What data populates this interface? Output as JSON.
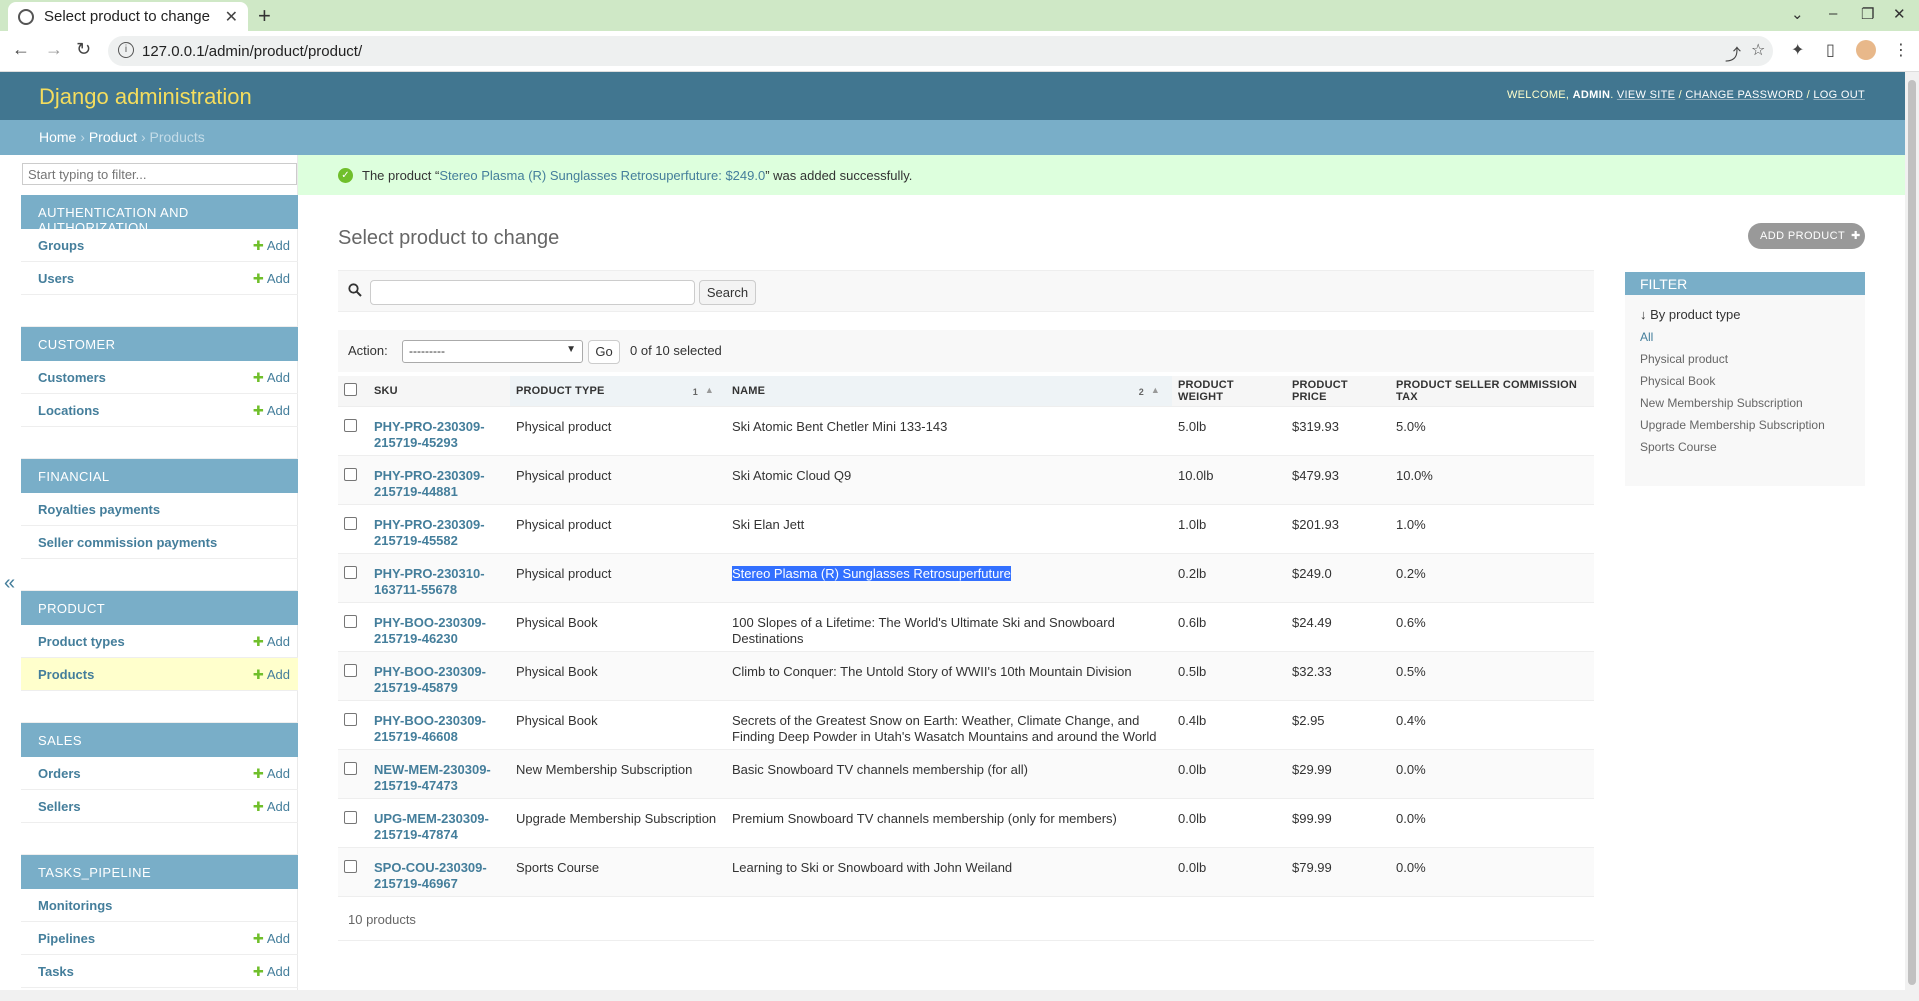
{
  "browser": {
    "tab_title": "Select product to change",
    "url": "127.0.0.1/admin/product/product/"
  },
  "header": {
    "branding": "Django administration",
    "welcome": "WELCOME,",
    "user": "ADMIN",
    "view_site": "VIEW SITE",
    "change_password": "CHANGE PASSWORD",
    "log_out": "LOG OUT"
  },
  "breadcrumbs": {
    "home": "Home",
    "app": "Product",
    "current": "Products"
  },
  "sidebar": {
    "filter_placeholder": "Start typing to filter...",
    "add_label": "Add",
    "apps": [
      {
        "caption": "AUTHENTICATION AND AUTHORIZATION",
        "models": [
          {
            "name": "Groups",
            "add": true
          },
          {
            "name": "Users",
            "add": true
          }
        ]
      },
      {
        "caption": "CUSTOMER",
        "models": [
          {
            "name": "Customers",
            "add": true
          },
          {
            "name": "Locations",
            "add": true
          }
        ]
      },
      {
        "caption": "FINANCIAL",
        "models": [
          {
            "name": "Royalties payments",
            "add": false
          },
          {
            "name": "Seller commission payments",
            "add": false
          }
        ]
      },
      {
        "caption": "PRODUCT",
        "models": [
          {
            "name": "Product types",
            "add": true
          },
          {
            "name": "Products",
            "add": true,
            "current": true
          }
        ]
      },
      {
        "caption": "SALES",
        "models": [
          {
            "name": "Orders",
            "add": true
          },
          {
            "name": "Sellers",
            "add": true
          }
        ]
      },
      {
        "caption": "TASKS_PIPELINE",
        "models": [
          {
            "name": "Monitorings",
            "add": false
          },
          {
            "name": "Pipelines",
            "add": true
          },
          {
            "name": "Tasks",
            "add": true
          }
        ]
      }
    ]
  },
  "message": {
    "prefix": "The product “",
    "link": "Stereo Plasma (R) Sunglasses Retrosuperfuture: $249.0",
    "suffix": "” was added successfully."
  },
  "content": {
    "title": "Select product to change",
    "add_button": "ADD PRODUCT",
    "search_button": "Search",
    "action_label": "Action:",
    "action_selected": "---------",
    "go_button": "Go",
    "selection_count": "0 of 10 selected",
    "paginator": "10 products"
  },
  "table": {
    "headers": {
      "sku": "SKU",
      "product_type": "PRODUCT TYPE",
      "product_type_sort": "1",
      "name": "NAME",
      "name_sort": "2",
      "weight": "PRODUCT WEIGHT",
      "price": "PRODUCT PRICE",
      "tax": "PRODUCT SELLER COMMISSION TAX"
    },
    "rows": [
      {
        "sku": "PHY-PRO-230309-215719-45293",
        "type": "Physical product",
        "name": "Ski Atomic Bent Chetler Mini 133-143",
        "weight": "5.0lb",
        "price": "$319.93",
        "tax": "5.0%"
      },
      {
        "sku": "PHY-PRO-230309-215719-44881",
        "type": "Physical product",
        "name": "Ski Atomic Cloud Q9",
        "weight": "10.0lb",
        "price": "$479.93",
        "tax": "10.0%"
      },
      {
        "sku": "PHY-PRO-230309-215719-45582",
        "type": "Physical product",
        "name": "Ski Elan Jett",
        "weight": "1.0lb",
        "price": "$201.93",
        "tax": "1.0%"
      },
      {
        "sku": "PHY-PRO-230310-163711-55678",
        "type": "Physical product",
        "name": "Stereo Plasma (R) Sunglasses Retrosuperfuture",
        "weight": "0.2lb",
        "price": "$249.0",
        "tax": "0.2%",
        "highlight": true
      },
      {
        "sku": "PHY-BOO-230309-215719-46230",
        "type": "Physical Book",
        "name": "100 Slopes of a Lifetime: The World's Ultimate Ski and Snowboard Destinations",
        "weight": "0.6lb",
        "price": "$24.49",
        "tax": "0.6%"
      },
      {
        "sku": "PHY-BOO-230309-215719-45879",
        "type": "Physical Book",
        "name": "Climb to Conquer: The Untold Story of WWII's 10th Mountain Division",
        "weight": "0.5lb",
        "price": "$32.33",
        "tax": "0.5%"
      },
      {
        "sku": "PHY-BOO-230309-215719-46608",
        "type": "Physical Book",
        "name": "Secrets of the Greatest Snow on Earth: Weather, Climate Change, and Finding Deep Powder in Utah's Wasatch Mountains and around the World",
        "weight": "0.4lb",
        "price": "$2.95",
        "tax": "0.4%"
      },
      {
        "sku": "NEW-MEM-230309-215719-47473",
        "type": "New Membership Subscription",
        "name": "Basic Snowboard TV channels membership (for all)",
        "weight": "0.0lb",
        "price": "$29.99",
        "tax": "0.0%"
      },
      {
        "sku": "UPG-MEM-230309-215719-47874",
        "type": "Upgrade Membership Subscription",
        "name": "Premium Snowboard TV channels membership (only for members)",
        "weight": "0.0lb",
        "price": "$99.99",
        "tax": "0.0%"
      },
      {
        "sku": "SPO-COU-230309-215719-46967",
        "type": "Sports Course",
        "name": "Learning to Ski or Snowboard with John Weiland",
        "weight": "0.0lb",
        "price": "$79.99",
        "tax": "0.0%"
      }
    ]
  },
  "filter": {
    "caption": "FILTER",
    "heading": "↓ By product type",
    "options": [
      {
        "label": "All",
        "selected": true
      },
      {
        "label": "Physical product"
      },
      {
        "label": "Physical Book"
      },
      {
        "label": "New Membership Subscription"
      },
      {
        "label": "Upgrade Membership Subscription"
      },
      {
        "label": "Sports Course"
      }
    ]
  },
  "colors": {
    "header_bg": "#417690",
    "branding": "#f5dd5d",
    "breadcrumbs_bg": "#79aec8",
    "link": "#447e9b",
    "success_bg": "#dddddd",
    "add_green": "#70bf2b",
    "current_row": "#ffffcc",
    "selection_highlight": "#3370ff"
  }
}
